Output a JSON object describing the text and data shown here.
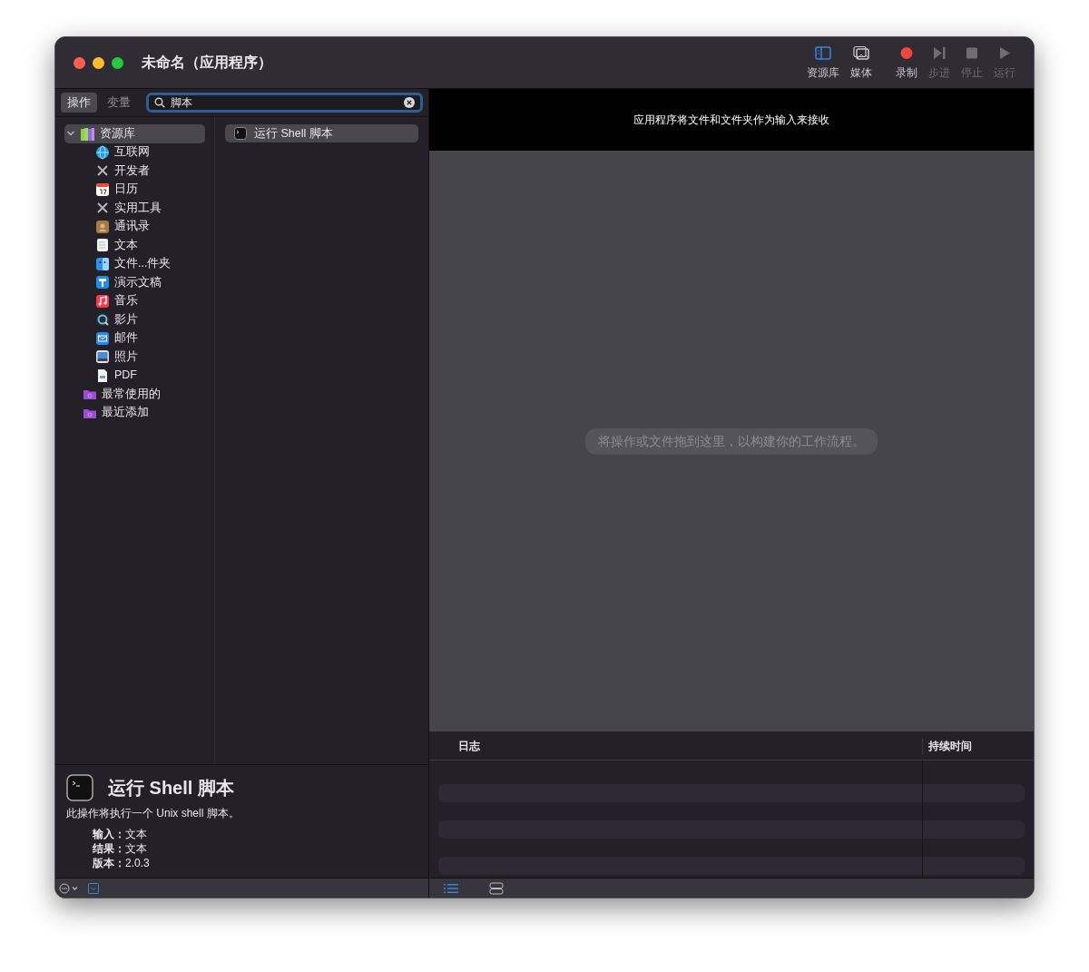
{
  "window": {
    "title": "未命名（应用程序）"
  },
  "toolbar": [
    {
      "kind": "library",
      "label": "资源库",
      "selected": true,
      "disabled": false
    },
    {
      "kind": "media",
      "label": "媒体",
      "selected": false,
      "disabled": false
    },
    {
      "kind": "record",
      "label": "录制",
      "selected": false,
      "disabled": false
    },
    {
      "kind": "step",
      "label": "步进",
      "selected": false,
      "disabled": true
    },
    {
      "kind": "stop",
      "label": "停止",
      "selected": false,
      "disabled": true
    },
    {
      "kind": "run",
      "label": "运行",
      "selected": false,
      "disabled": true
    }
  ],
  "tabs": [
    {
      "label": "操作",
      "selected": true
    },
    {
      "label": "变量",
      "selected": false
    }
  ],
  "search": {
    "value": "脚本"
  },
  "library": {
    "label": "资源库",
    "expanded": true,
    "selected": true,
    "children": [
      {
        "kind": "globe",
        "label": "互联网"
      },
      {
        "kind": "tools",
        "label": "开发者"
      },
      {
        "kind": "calendar",
        "label": "日历"
      },
      {
        "kind": "tools",
        "label": "实用工具"
      },
      {
        "kind": "contacts",
        "label": "通讯录"
      },
      {
        "kind": "notepad",
        "label": "文本"
      },
      {
        "kind": "finder",
        "label": "文件...件夹"
      },
      {
        "kind": "keynote",
        "label": "演示文稿"
      },
      {
        "kind": "music",
        "label": "音乐"
      },
      {
        "kind": "movie",
        "label": "影片"
      },
      {
        "kind": "mail",
        "label": "邮件"
      },
      {
        "kind": "photo",
        "label": "照片"
      },
      {
        "kind": "pdf",
        "label": "PDF"
      }
    ]
  },
  "smart_folders": [
    {
      "label": "最常使用的"
    },
    {
      "label": "最近添加"
    }
  ],
  "results": [
    {
      "label": "运行 Shell 脚本",
      "selected": true
    }
  ],
  "description": {
    "title": "运行 Shell 脚本",
    "text": "此操作将执行一个 Unix shell 脚本。",
    "details": [
      {
        "label": "输入：",
        "value": "文本"
      },
      {
        "label": "结果：",
        "value": "文本"
      },
      {
        "label": "版本：",
        "value": "2.0.3"
      }
    ]
  },
  "workflow": {
    "header": "应用程序将文件和文件夹作为输入来接收",
    "hint": "将操作或文件拖到这里，以构建你的工作流程。"
  },
  "log": {
    "columns": [
      "日志",
      "持续时间"
    ]
  },
  "view_buttons": [
    {
      "kind": "list",
      "selected": true
    },
    {
      "kind": "rows",
      "selected": false
    }
  ]
}
